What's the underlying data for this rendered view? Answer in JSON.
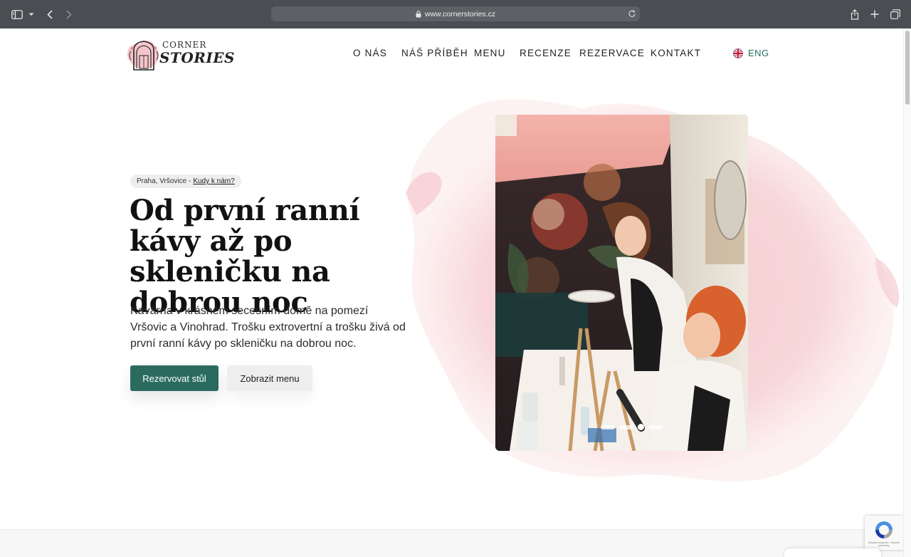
{
  "browser": {
    "url": "www.cornerstories.cz"
  },
  "logo": {
    "word1": "CORNER",
    "word2": "STORIES"
  },
  "nav": {
    "items": [
      {
        "label": "O NÁS"
      },
      {
        "label": "NÁŠ PŘÍBĚH"
      },
      {
        "label": "MENU"
      },
      {
        "label": "RECENZE"
      },
      {
        "label": "REZERVACE"
      },
      {
        "label": "KONTAKT"
      }
    ],
    "language": "ENG"
  },
  "hero": {
    "location": "Praha, Vršovice -",
    "location_link": "Kudy k nám?",
    "title": "Od první ranní kávy až po skleničku na dobrou noc",
    "description": "Kavárna v krásném secesním domě na pomezí Vršovic a Vinohrad. Trošku extrovertní a trošku živá od první ranní kávy po skleničku na dobrou noc.",
    "primary_button": "Rezervovat stůl",
    "secondary_button": "Zobrazit menu"
  },
  "carousel": {
    "slide_count": 4,
    "active_index": 2
  },
  "recaptcha": {
    "footer_text": "Ochrana soukromí - Smluvní podmínky"
  },
  "colors": {
    "accent": "#2b6b5f",
    "language_text": "#2a6b61",
    "blob": "#f4c9cc",
    "chrome": "#4a4d51"
  },
  "icons": {
    "sidebar": "sidebar-icon",
    "back": "chevron-left-icon",
    "forward": "chevron-right-icon",
    "lock": "lock-icon",
    "reload": "reload-icon",
    "share": "share-icon",
    "new_tab": "plus-icon",
    "tabs": "tabs-overview-icon",
    "flag": "uk-flag-icon"
  }
}
